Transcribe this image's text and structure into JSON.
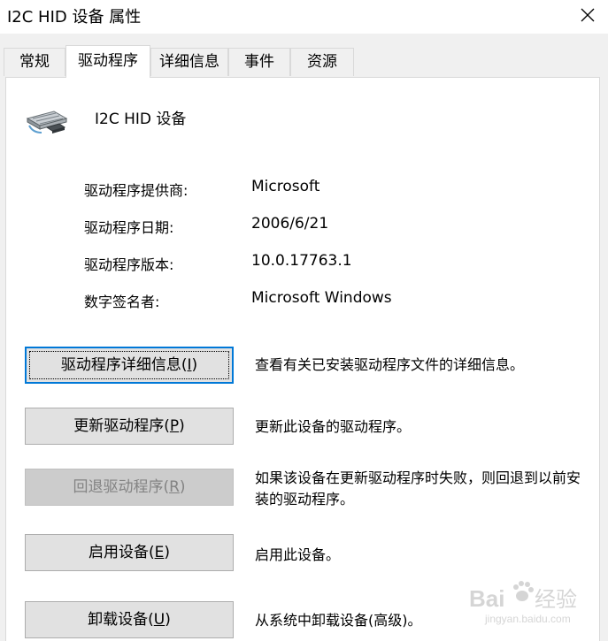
{
  "window": {
    "title": "I2C HID 设备 属性"
  },
  "tabs": [
    {
      "label": "常规",
      "active": false
    },
    {
      "label": "驱动程序",
      "active": true
    },
    {
      "label": "详细信息",
      "active": false
    },
    {
      "label": "事件",
      "active": false
    },
    {
      "label": "资源",
      "active": false
    }
  ],
  "device": {
    "name": "I2C HID 设备",
    "icon": "hid-device-icon"
  },
  "driver_info": {
    "provider_label": "驱动程序提供商:",
    "provider_value": "Microsoft",
    "date_label": "驱动程序日期:",
    "date_value": "2006/6/21",
    "version_label": "驱动程序版本:",
    "version_value": "10.0.17763.1",
    "signer_label": "数字签名者:",
    "signer_value": "Microsoft Windows"
  },
  "actions": {
    "details": {
      "label": "驱动程序详细信息(",
      "mnemonic": "I",
      "suffix": ")",
      "description": "查看有关已安装驱动程序文件的详细信息。"
    },
    "update": {
      "label": "更新驱动程序(",
      "mnemonic": "P",
      "suffix": ")",
      "description": "更新此设备的驱动程序。"
    },
    "rollback": {
      "label": "回退驱动程序(",
      "mnemonic": "R",
      "suffix": ")",
      "description": "如果该设备在更新驱动程序时失败，则回退到以前安装的驱动程序。"
    },
    "enable": {
      "label": "启用设备(",
      "mnemonic": "E",
      "suffix": ")",
      "description": "启用此设备。"
    },
    "uninstall": {
      "label": "卸载设备(",
      "mnemonic": "U",
      "suffix": ")",
      "description": "从系统中卸载设备(高级)。"
    }
  },
  "watermark": {
    "brand": "Bai",
    "brand2": "经验",
    "site": "jingyan.baidu.com"
  },
  "colors": {
    "focus": "#0078d7",
    "button_bg": "#e1e1e1",
    "disabled_bg": "#cccccc",
    "disabled_text": "#838383"
  }
}
